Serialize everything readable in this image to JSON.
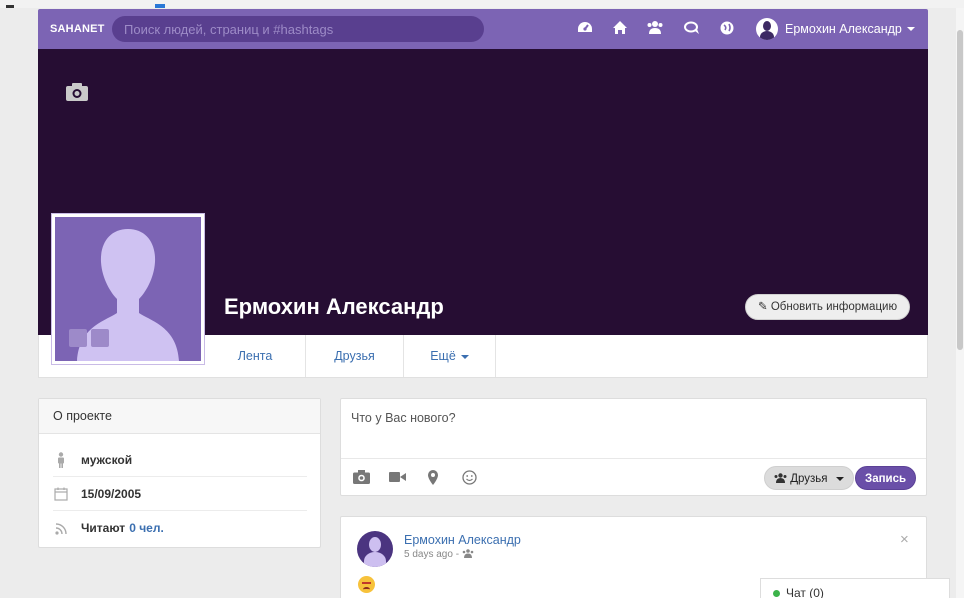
{
  "nav": {
    "brand": "SAHANET",
    "search_placeholder": "Поиск людей, страниц и #hashtags",
    "user_name": "Ермохин Александр",
    "icons": [
      "dashboard-icon",
      "home-icon",
      "users-icon",
      "comments-icon",
      "globe-icon"
    ]
  },
  "profile": {
    "name": "Ермохин Александр",
    "update_button": "Обновить информацию",
    "tabs": [
      "Лента",
      "Друзья",
      "Ещё"
    ]
  },
  "about": {
    "title": "О проекте",
    "gender": "мужской",
    "birthdate": "15/09/2005",
    "followers_label": "Читают",
    "followers_value": "0 чел."
  },
  "composer": {
    "placeholder": "Что у Вас нового?",
    "audience_button": "Друзья",
    "post_button": "Запись"
  },
  "post": {
    "author": "Ермохин Александр",
    "time": "5 days ago -"
  },
  "chat": {
    "label": "Чат (0)"
  },
  "colors": {
    "navbar": "#7c64b4",
    "cover": "#260d33",
    "link": "#3b6fb0",
    "accent": "#6a4fa8"
  }
}
